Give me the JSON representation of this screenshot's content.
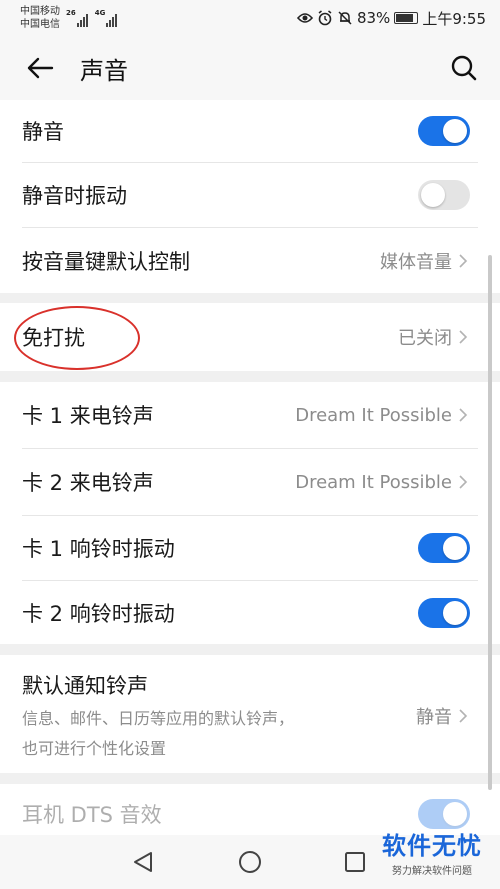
{
  "status_bar": {
    "carrier_1": "中国移动",
    "carrier_2": "中国电信",
    "sig_1_tag": "26",
    "sig_2_tag": "4G",
    "battery_percent": "83%",
    "battery_level": 0.83,
    "time": "上午9:55",
    "icons": [
      "eye-icon",
      "alarm-icon",
      "mute-bell-icon",
      "battery-icon"
    ]
  },
  "header": {
    "title": "声音",
    "back_icon": "arrow-left-icon",
    "search_icon": "search-icon"
  },
  "settings": {
    "mute": {
      "label": "静音",
      "on": true
    },
    "vibrate_on_mute": {
      "label": "静音时振动",
      "on": false
    },
    "volume_key": {
      "label": "按音量键默认控制",
      "value": "媒体音量"
    },
    "dnd": {
      "label": "免打扰",
      "value": "已关闭"
    },
    "sim1_ringtone": {
      "label": "卡 1 来电铃声",
      "value": "Dream It Possible"
    },
    "sim2_ringtone": {
      "label": "卡 2 来电铃声",
      "value": "Dream It Possible"
    },
    "sim1_vibrate": {
      "label": "卡 1 响铃时振动",
      "on": true
    },
    "sim2_vibrate": {
      "label": "卡 2 响铃时振动",
      "on": true
    },
    "notification_tone": {
      "label": "默认通知铃声",
      "desc_line1": "信息、邮件、日历等应用的默认铃声，",
      "desc_line2": "也可进行个性化设置",
      "value": "静音"
    },
    "dts": {
      "label": "耳机 DTS 音效",
      "on": true
    }
  },
  "nav": {
    "back": "triangle-back-icon",
    "home": "circle-home-icon",
    "recents": "square-recents-icon"
  },
  "watermark": {
    "title": "软件无忧",
    "subtitle": "努力解决软件问题"
  },
  "colors": {
    "accent": "#1a73e8",
    "annotation": "#d9312b",
    "watermark": "#1a66d9"
  }
}
